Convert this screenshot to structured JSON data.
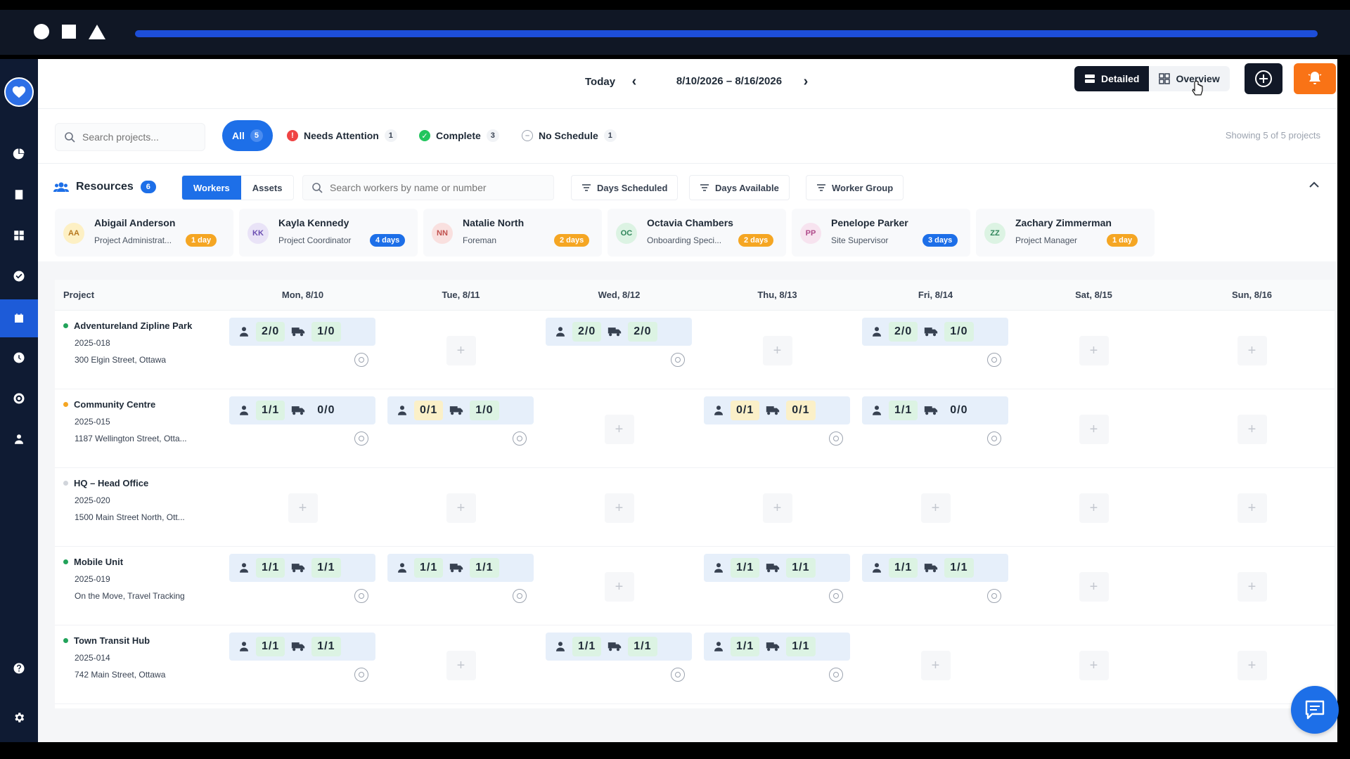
{
  "topbar": {
    "today_label": "Today",
    "date_range": "8/10/2026 – 8/16/2026",
    "detailed_label": "Detailed",
    "overview_label": "Overview"
  },
  "filters": {
    "search_placeholder": "Search projects...",
    "chips": [
      {
        "label": "All",
        "count": "5",
        "active": true
      },
      {
        "label": "Needs Attention",
        "count": "1",
        "color": "#ef4444"
      },
      {
        "label": "Complete",
        "count": "3",
        "color": "#22c55e"
      },
      {
        "label": "No Schedule",
        "count": "1",
        "color": "#9ca3af"
      }
    ],
    "showing_text": "Showing 5 of 5 projects"
  },
  "resources": {
    "title": "Resources",
    "count": "6",
    "tab_workers": "Workers",
    "tab_assets": "Assets",
    "search_placeholder": "Search workers by name or number",
    "filter_days_scheduled": "Days Scheduled",
    "filter_days_available": "Days Available",
    "filter_worker_group": "Worker Group",
    "workers": [
      {
        "initials": "AA",
        "name": "Abigail Anderson",
        "role": "Project Administrat...",
        "badge": "1 day",
        "badge_color": "#f5a623",
        "avatar_bg": "#fdf0c4",
        "avatar_fg": "#b7791f"
      },
      {
        "initials": "KK",
        "name": "Kayla Kennedy",
        "role": "Project Coordinator",
        "badge": "4 days",
        "badge_color": "#1d6fe8",
        "avatar_bg": "#e9e3f7",
        "avatar_fg": "#6b4fb2"
      },
      {
        "initials": "NN",
        "name": "Natalie North",
        "role": "Foreman",
        "badge": "2 days",
        "badge_color": "#f5a623",
        "avatar_bg": "#f9e0df",
        "avatar_fg": "#c0504d"
      },
      {
        "initials": "OC",
        "name": "Octavia Chambers",
        "role": "Onboarding Speci...",
        "badge": "2 days",
        "badge_color": "#f5a623",
        "avatar_bg": "#dcf3e3",
        "avatar_fg": "#2f855a"
      },
      {
        "initials": "PP",
        "name": "Penelope Parker",
        "role": "Site Supervisor",
        "badge": "3 days",
        "badge_color": "#1d6fe8",
        "avatar_bg": "#f7e3ef",
        "avatar_fg": "#b04a8a"
      },
      {
        "initials": "ZZ",
        "name": "Zachary Zimmerman",
        "role": "Project Manager",
        "badge": "1 day",
        "badge_color": "#f5a623",
        "avatar_bg": "#dcf3e3",
        "avatar_fg": "#2f855a"
      }
    ]
  },
  "grid": {
    "project_header": "Project",
    "days": [
      "Mon, 8/10",
      "Tue, 8/11",
      "Wed, 8/12",
      "Thu, 8/13",
      "Fri, 8/14",
      "Sat, 8/15",
      "Sun, 8/16"
    ],
    "projects": [
      {
        "name": "Adventureland Zipline Park",
        "code": "2025-018",
        "address": "300 Elgin Street, Ottawa",
        "status_color": "#22a35a",
        "cells": [
          {
            "w": "2/0",
            "wc": "g",
            "a": "1/0",
            "ac": "g"
          },
          null,
          {
            "w": "2/0",
            "wc": "g",
            "a": "2/0",
            "ac": "g"
          },
          null,
          {
            "w": "2/0",
            "wc": "g",
            "a": "1/0",
            "ac": "g"
          },
          null,
          null
        ]
      },
      {
        "name": "Community Centre",
        "code": "2025-015",
        "address": "1187 Wellington Street, Otta...",
        "status_color": "#f5a623",
        "cells": [
          {
            "w": "1/1",
            "wc": "g",
            "a": "0/0",
            "ac": "n"
          },
          {
            "w": "0/1",
            "wc": "y",
            "a": "1/0",
            "ac": "g"
          },
          null,
          {
            "w": "0/1",
            "wc": "y",
            "a": "0/1",
            "ac": "y"
          },
          {
            "w": "1/1",
            "wc": "g",
            "a": "0/0",
            "ac": "n"
          },
          null,
          null
        ]
      },
      {
        "name": "HQ – Head Office",
        "code": "2025-020",
        "address": "1500 Main Street North, Ott...",
        "status_color": "#d1d5db",
        "cells": [
          null,
          null,
          null,
          null,
          null,
          null,
          null
        ]
      },
      {
        "name": "Mobile Unit",
        "code": "2025-019",
        "address": "On the Move, Travel Tracking",
        "status_color": "#22a35a",
        "cells": [
          {
            "w": "1/1",
            "wc": "g",
            "a": "1/1",
            "ac": "g"
          },
          {
            "w": "1/1",
            "wc": "g",
            "a": "1/1",
            "ac": "g"
          },
          null,
          {
            "w": "1/1",
            "wc": "g",
            "a": "1/1",
            "ac": "g"
          },
          {
            "w": "1/1",
            "wc": "g",
            "a": "1/1",
            "ac": "g"
          },
          null,
          null
        ]
      },
      {
        "name": "Town Transit Hub",
        "code": "2025-014",
        "address": "742 Main Street, Ottawa",
        "status_color": "#22a35a",
        "cells": [
          {
            "w": "1/1",
            "wc": "g",
            "a": "1/1",
            "ac": "g"
          },
          null,
          {
            "w": "1/1",
            "wc": "g",
            "a": "1/1",
            "ac": "g"
          },
          {
            "w": "1/1",
            "wc": "g",
            "a": "1/1",
            "ac": "g"
          },
          null,
          null,
          null
        ]
      }
    ]
  },
  "colors": {
    "primary": "#1d6fe8",
    "sidebar": "#0f1b33",
    "accent_orange": "#f97316"
  }
}
